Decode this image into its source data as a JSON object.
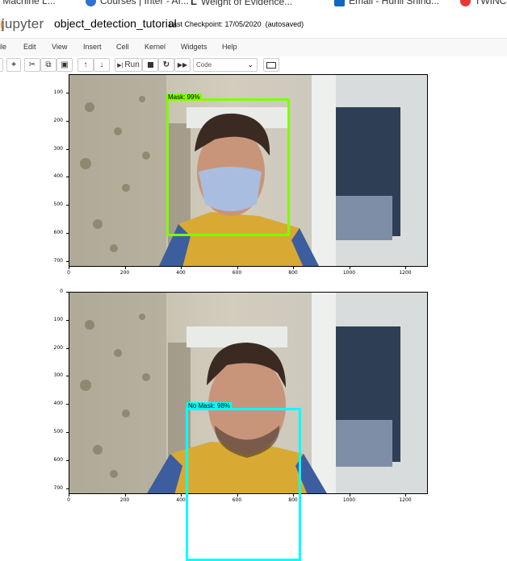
{
  "browser": {
    "bookmarks": [
      {
        "label": "r Machine L...",
        "icon": "bookmark-icon"
      },
      {
        "label": "Courses | Inter - AI...",
        "icon": "courses-icon"
      },
      {
        "label": "Weight of Evidence...",
        "icon": "doc-icon"
      },
      {
        "label": "Email - Hunil Shind...",
        "icon": "email-icon"
      },
      {
        "label": "TWINC",
        "icon": "site-icon"
      }
    ]
  },
  "header": {
    "logo": "jupyter",
    "notebook_title": "object_detection_tutorial",
    "checkpoint": "Last Checkpoint: 17/05/2020",
    "autosave": "(autosaved)"
  },
  "menubar": [
    "ile",
    "Edit",
    "View",
    "Insert",
    "Cell",
    "Kernel",
    "Widgets",
    "Help"
  ],
  "toolbar": {
    "run_label": "Run",
    "cell_type": "Code"
  },
  "plots": [
    {
      "yticks": [
        "100",
        "200",
        "300",
        "400",
        "500",
        "600",
        "700"
      ],
      "xticks": [
        "0",
        "200",
        "400",
        "600",
        "800",
        "1000",
        "1200"
      ],
      "detection": {
        "label": "Mask: 99%",
        "color": "#7fff00"
      }
    },
    {
      "yticks": [
        "0",
        "100",
        "200",
        "300",
        "400",
        "500",
        "600",
        "700"
      ],
      "xticks": [
        "0",
        "200",
        "400",
        "600",
        "800",
        "1000",
        "1200"
      ],
      "detection": {
        "label": "No Mask: 98%",
        "color": "#00ffff"
      }
    }
  ]
}
